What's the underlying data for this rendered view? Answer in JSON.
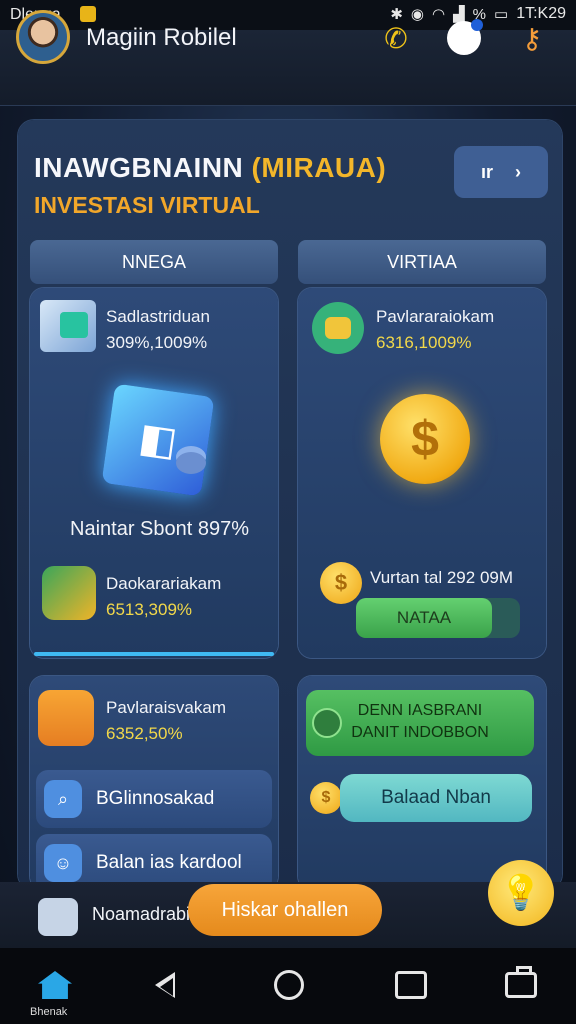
{
  "status_bar": {
    "left_text": "Dlenga",
    "time": "1T:K29",
    "battery_glyph": "%"
  },
  "header": {
    "user_name": "Magiin Robilel"
  },
  "panel": {
    "title": "INAWGBNAINN",
    "title_highlight": "(MIRAUA)",
    "subtitle": "INVESTASI VIRTUAL",
    "top_action_label": "ır"
  },
  "tabs": {
    "left": "NNEGA",
    "right": "VIRTIAA"
  },
  "left_card": {
    "item1_label": "Sadlastriduan",
    "item1_value": "309%,1009%",
    "center_stat": "Naintar Sbont 897%",
    "item2_label": "Daokarariakam",
    "item2_value": "6513,309%"
  },
  "right_card": {
    "item3_label": "Pavlararaiokam",
    "item3_value": "6316,1009%",
    "coin_symbol": "$",
    "item4_label": "Vurtan tal 292 09M",
    "button_label": "NATAA"
  },
  "bottom_left": {
    "item5_label": "Pavlaraisvakam",
    "item5_value": "6352,50%",
    "row1_label": "BGlinnosakad",
    "row2_label": "Balan ias kardool"
  },
  "bottom_right": {
    "banner_line1": "DENN IASBRANI",
    "banner_line2": "DANIT INDOBBON",
    "button_label": "Balaad Nban"
  },
  "bottom_strip": {
    "label": "Noamadrabil",
    "button_label": "Hiskar ohallen"
  },
  "nav": {
    "home_label": "Bhenak"
  },
  "icons": {
    "phone": "phone-sparkle-icon",
    "chat": "chat-bubble-icon",
    "key": "key-icon",
    "bulb": "lightbulb-icon"
  },
  "colors": {
    "accent_orange": "#f3b62a",
    "accent_green": "#4fb95c",
    "panel": "#24395a"
  }
}
